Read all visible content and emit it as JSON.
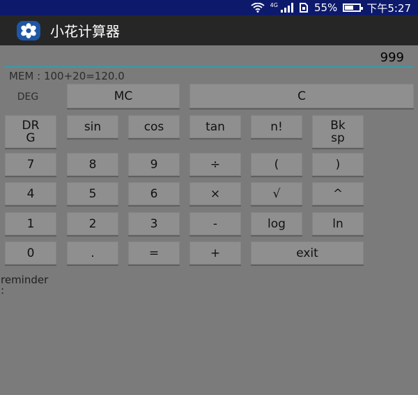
{
  "status_bar": {
    "network_label": "4G",
    "battery_percent": "55%",
    "battery_level": 0.55,
    "time": "下午5:27",
    "icons": [
      "wifi-icon",
      "signal-icon",
      "sim-icon",
      "battery-icon"
    ]
  },
  "app": {
    "title": "小花计算器",
    "icon": "flower-icon",
    "icon_color": "#1d57a5"
  },
  "display": {
    "value": "999",
    "memory_text": "MEM :  100+20=120.0",
    "mode_label": "DEG"
  },
  "buttons": {
    "mc": "MC",
    "c": "C",
    "drg": "DR\nG",
    "sin": "sin",
    "cos": "cos",
    "tan": "tan",
    "fact": "n!",
    "bksp": "Bk\nsp",
    "d7": "7",
    "d8": "8",
    "d9": "9",
    "div": "÷",
    "lparen": "(",
    "rparen": ")",
    "d4": "4",
    "d5": "5",
    "d6": "6",
    "mul": "×",
    "sqrt": "√",
    "pow": "^",
    "d1": "1",
    "d2": "2",
    "d3": "3",
    "sub": "-",
    "log": "log",
    "ln": "ln",
    "d0": "0",
    "dot": ".",
    "eq": "=",
    "add": "+",
    "exit": "exit"
  },
  "reminder": "reminder\n:"
}
